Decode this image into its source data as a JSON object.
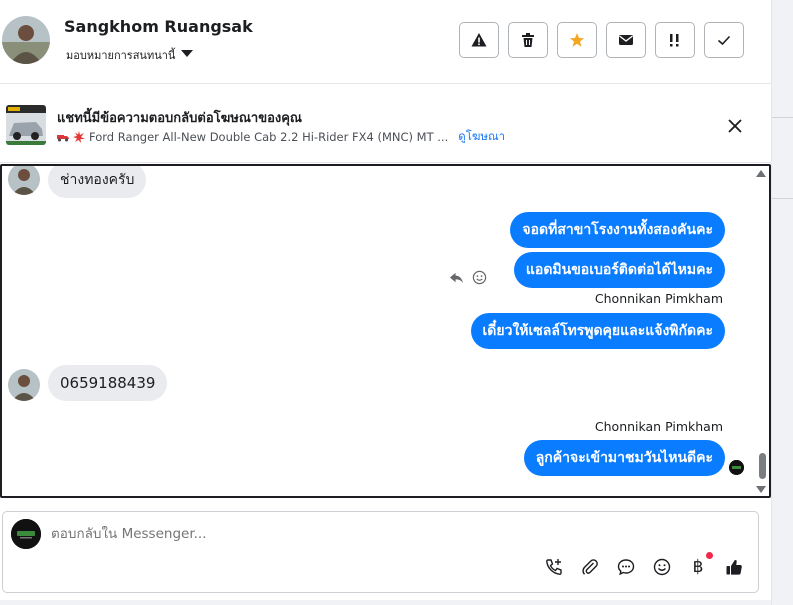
{
  "header": {
    "contact_name": "Sangkhom Ruangsak",
    "assign_label": "มอบหมายการสนทนานี้",
    "actions": [
      "spam-icon",
      "trash-icon",
      "star-icon",
      "mail-icon",
      "follow-up-icon",
      "done-icon"
    ]
  },
  "banner": {
    "title": "แชทนี้มีข้อความตอบกลับต่อโฆษณาของคุณ",
    "ad_text": "Ford Ranger All-New Double Cab 2.2 Hi-Rider FX4 (MNC) MT ...",
    "view_ad": "ดูโฆษณา"
  },
  "chat": {
    "messages": [
      {
        "dir": "in",
        "text": "ช่างทองครับ"
      },
      {
        "dir": "out",
        "text": "จอดที่สาขาโรงงานทั้งสองคันคะ"
      },
      {
        "dir": "out",
        "text": "แอดมินขอเบอร์ติดต่อได้ไหมคะ"
      },
      {
        "dir": "out",
        "sender": "Chonnikan Pimkham",
        "text": "เดี๋ยวให้เซลล์โทรพูดคุยและแจ้งพิกัดคะ"
      },
      {
        "dir": "in",
        "text": "0659188439"
      },
      {
        "dir": "out",
        "sender": "Chonnikan Pimkham",
        "text": "ลูกค้าจะเข้ามาชมวันไหนดีคะ"
      }
    ]
  },
  "composer": {
    "placeholder": "ตอบกลับใน Messenger...",
    "tools": [
      "call-add-icon",
      "attach-icon",
      "saved-reply-icon",
      "emoji-icon",
      "baht-icon",
      "like-icon"
    ],
    "baht_symbol": "฿"
  },
  "colors": {
    "outgoing_bubble": "#0a7cff",
    "incoming_bubble": "#e9ebee",
    "link": "#1877f2",
    "star": "#f5a623",
    "notification_dot": "#f02849"
  }
}
